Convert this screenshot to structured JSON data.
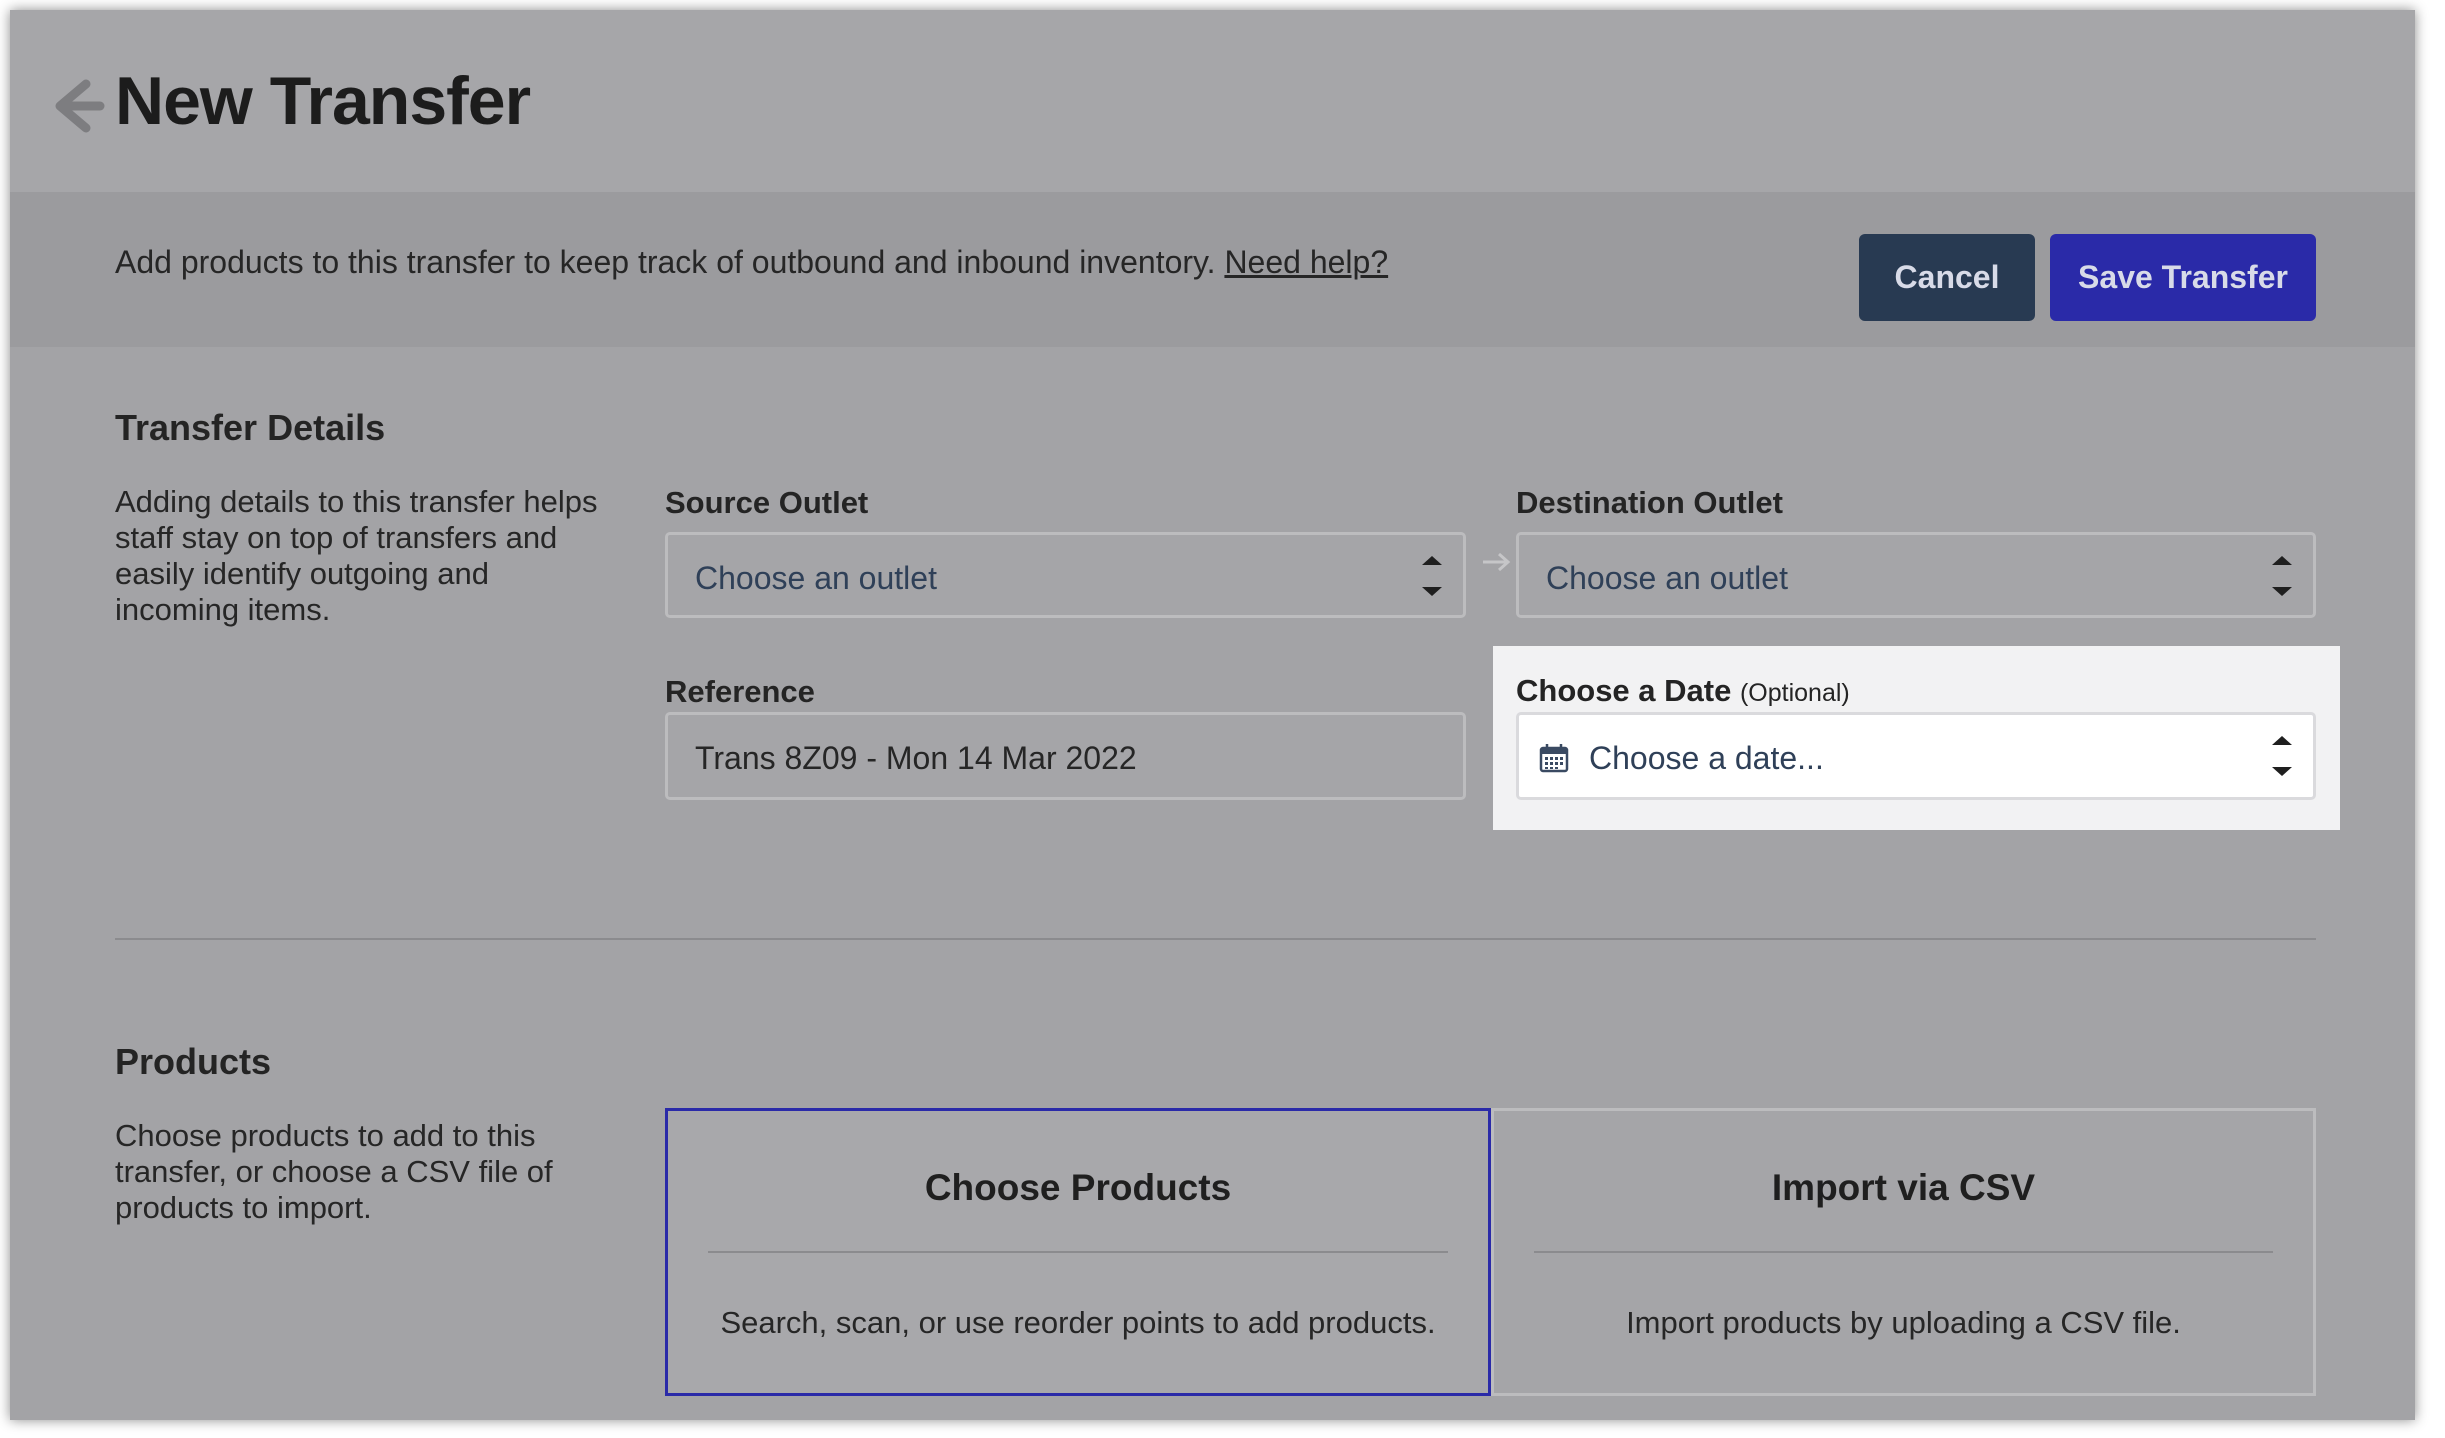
{
  "header": {
    "title": "New Transfer"
  },
  "banner": {
    "text": "Add products to this transfer to keep track of outbound and inbound inventory.",
    "help_link": "Need help?",
    "cancel_label": "Cancel",
    "save_label": "Save Transfer"
  },
  "details": {
    "title": "Transfer Details",
    "description": "Adding details to this transfer helps staff stay on top of transfers and easily identify outgoing and incoming items.",
    "source_label": "Source Outlet",
    "source_value": "Choose an outlet",
    "destination_label": "Destination Outlet",
    "destination_value": "Choose an outlet",
    "reference_label": "Reference",
    "reference_value": "Trans 8Z09 - Mon 14 Mar 2022",
    "date_label": "Choose a Date",
    "date_optional": "(Optional)",
    "date_placeholder": "Choose a date..."
  },
  "products": {
    "title": "Products",
    "description": "Choose products to add to this transfer, or choose a CSV file of products to import.",
    "cards": [
      {
        "title": "Choose Products",
        "description": "Search, scan, or use reorder points to add products.",
        "selected": true
      },
      {
        "title": "Import via CSV",
        "description": "Import products by uploading a CSV file.",
        "selected": false
      }
    ]
  },
  "colors": {
    "primary_button": "#2a2aa8",
    "cancel_button": "#283a52",
    "selected_border": "#2a2aa8",
    "highlight_panel": "#f2f2f3"
  },
  "icons": {
    "back": "arrow-left-icon",
    "stepper": "up-down-stepper-icon",
    "direction": "arrow-right-icon",
    "calendar": "calendar-icon"
  }
}
